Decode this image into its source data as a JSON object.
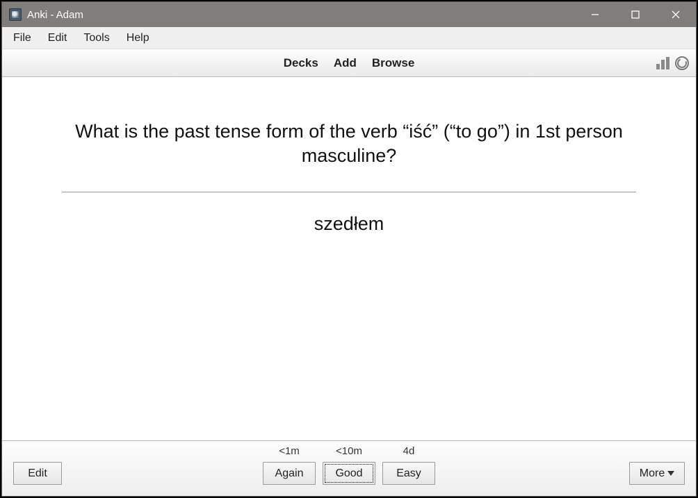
{
  "window": {
    "title": "Anki - Adam"
  },
  "menubar": {
    "file": "File",
    "edit": "Edit",
    "tools": "Tools",
    "help": "Help"
  },
  "toolbar": {
    "decks": "Decks",
    "add": "Add",
    "browse": "Browse"
  },
  "card": {
    "question": "What is the past tense form of the verb “iść” (“to go”) in 1st person masculine?",
    "answer": "szedłem"
  },
  "review": {
    "intervals": {
      "again": "<1m",
      "good": "<10m",
      "easy": "4d"
    },
    "buttons": {
      "again": "Again",
      "good": "Good",
      "easy": "Easy"
    }
  },
  "bottom": {
    "edit": "Edit",
    "more": "More"
  }
}
